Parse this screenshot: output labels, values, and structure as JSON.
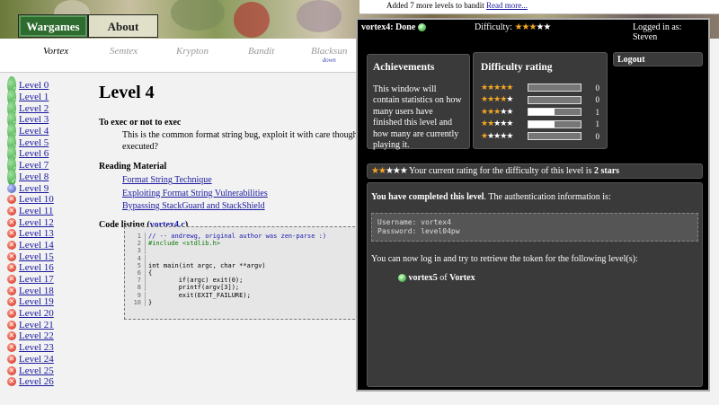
{
  "header": {
    "tabs": [
      {
        "label": "Wargames"
      },
      {
        "label": "About"
      }
    ]
  },
  "games": [
    {
      "label": "Vortex",
      "sub": ""
    },
    {
      "label": "Semtex",
      "sub": ""
    },
    {
      "label": "Krypton",
      "sub": ""
    },
    {
      "label": "Bandit",
      "sub": ""
    },
    {
      "label": "Blacksun",
      "sub": "down"
    }
  ],
  "sidebar": {
    "levels": [
      {
        "label": "Level 0",
        "status": "done"
      },
      {
        "label": "Level 1",
        "status": "done"
      },
      {
        "label": "Level 2",
        "status": "done"
      },
      {
        "label": "Level 3",
        "status": "done"
      },
      {
        "label": "Level 4",
        "status": "done"
      },
      {
        "label": "Level 5",
        "status": "done"
      },
      {
        "label": "Level 6",
        "status": "done"
      },
      {
        "label": "Level 7",
        "status": "done"
      },
      {
        "label": "Level 8",
        "status": "done"
      },
      {
        "label": "Level 9",
        "status": "current"
      },
      {
        "label": "Level 10",
        "status": "no"
      },
      {
        "label": "Level 11",
        "status": "no"
      },
      {
        "label": "Level 12",
        "status": "no"
      },
      {
        "label": "Level 13",
        "status": "no"
      },
      {
        "label": "Level 14",
        "status": "no"
      },
      {
        "label": "Level 15",
        "status": "no"
      },
      {
        "label": "Level 16",
        "status": "no"
      },
      {
        "label": "Level 17",
        "status": "no"
      },
      {
        "label": "Level 18",
        "status": "no"
      },
      {
        "label": "Level 19",
        "status": "no"
      },
      {
        "label": "Level 20",
        "status": "no"
      },
      {
        "label": "Level 21",
        "status": "no"
      },
      {
        "label": "Level 22",
        "status": "no"
      },
      {
        "label": "Level 23",
        "status": "no"
      },
      {
        "label": "Level 24",
        "status": "no"
      },
      {
        "label": "Level 25",
        "status": "no"
      },
      {
        "label": "Level 26",
        "status": "no"
      }
    ]
  },
  "main": {
    "title": "Level 4",
    "subtitle": "To exec or not to exec",
    "description": "This is the common format string bug, exploit it with care though executed?",
    "reading_heading": "Reading Material",
    "links": [
      "Format String Technique",
      "Exploiting Format String Vulnerabilities",
      "Bypassing StackGuard and StackShield"
    ],
    "code_heading": "Code listing (",
    "code_link": "vortex4.c",
    "code_heading_end": ")",
    "code": [
      {
        "n": "1",
        "text": "// -- andrewg, original author was zen-parse :)"
      },
      {
        "n": "2",
        "text": "#include <stdlib.h>"
      },
      {
        "n": "3",
        "text": ""
      },
      {
        "n": "4",
        "text": ""
      },
      {
        "n": "5",
        "text": "int main(int argc, char **argv)"
      },
      {
        "n": "6",
        "text": "{"
      },
      {
        "n": "7",
        "text": "        if(argc) exit(0);"
      },
      {
        "n": "8",
        "text": "        printf(argv[3]);"
      },
      {
        "n": "9",
        "text": "        exit(EXIT_FAILURE);"
      },
      {
        "n": "10",
        "text": "}"
      }
    ]
  },
  "notice": {
    "text": "Added 7 more levels to bandit ",
    "link": "Read more..."
  },
  "panel": {
    "level_status": "vortex4: Done",
    "difficulty_label": "Difficulty:",
    "difficulty_stars": 3,
    "logged_in": "Logged in as: Steven",
    "achievements_title": "Achievements",
    "achievements_text": "This window will contain statistics on how many users have finished this level and how many are currently playing it.",
    "rating_title": "Difficulty rating",
    "ratings": [
      {
        "stars": 5,
        "fill": 0.0,
        "count": "0"
      },
      {
        "stars": 4,
        "fill": 0.0,
        "count": "0"
      },
      {
        "stars": 3,
        "fill": 0.5,
        "count": "1"
      },
      {
        "stars": 2,
        "fill": 0.5,
        "count": "1"
      },
      {
        "stars": 1,
        "fill": 0.0,
        "count": "0"
      }
    ],
    "logout": "Logout",
    "current_rating_stars": 2,
    "current_rating_text": "Your current rating for the difficulty of this level is ",
    "current_rating_value": "2 stars",
    "completed_bold": "You have completed this level",
    "completed_rest": ". The authentication information is:",
    "username": "Username: vortex4",
    "password": "Password: level04pw",
    "next_text": "You can now log in and try to retrieve the token for the following level(s):",
    "next_level": "vortex5",
    "next_of": " of ",
    "next_game": "Vortex"
  }
}
